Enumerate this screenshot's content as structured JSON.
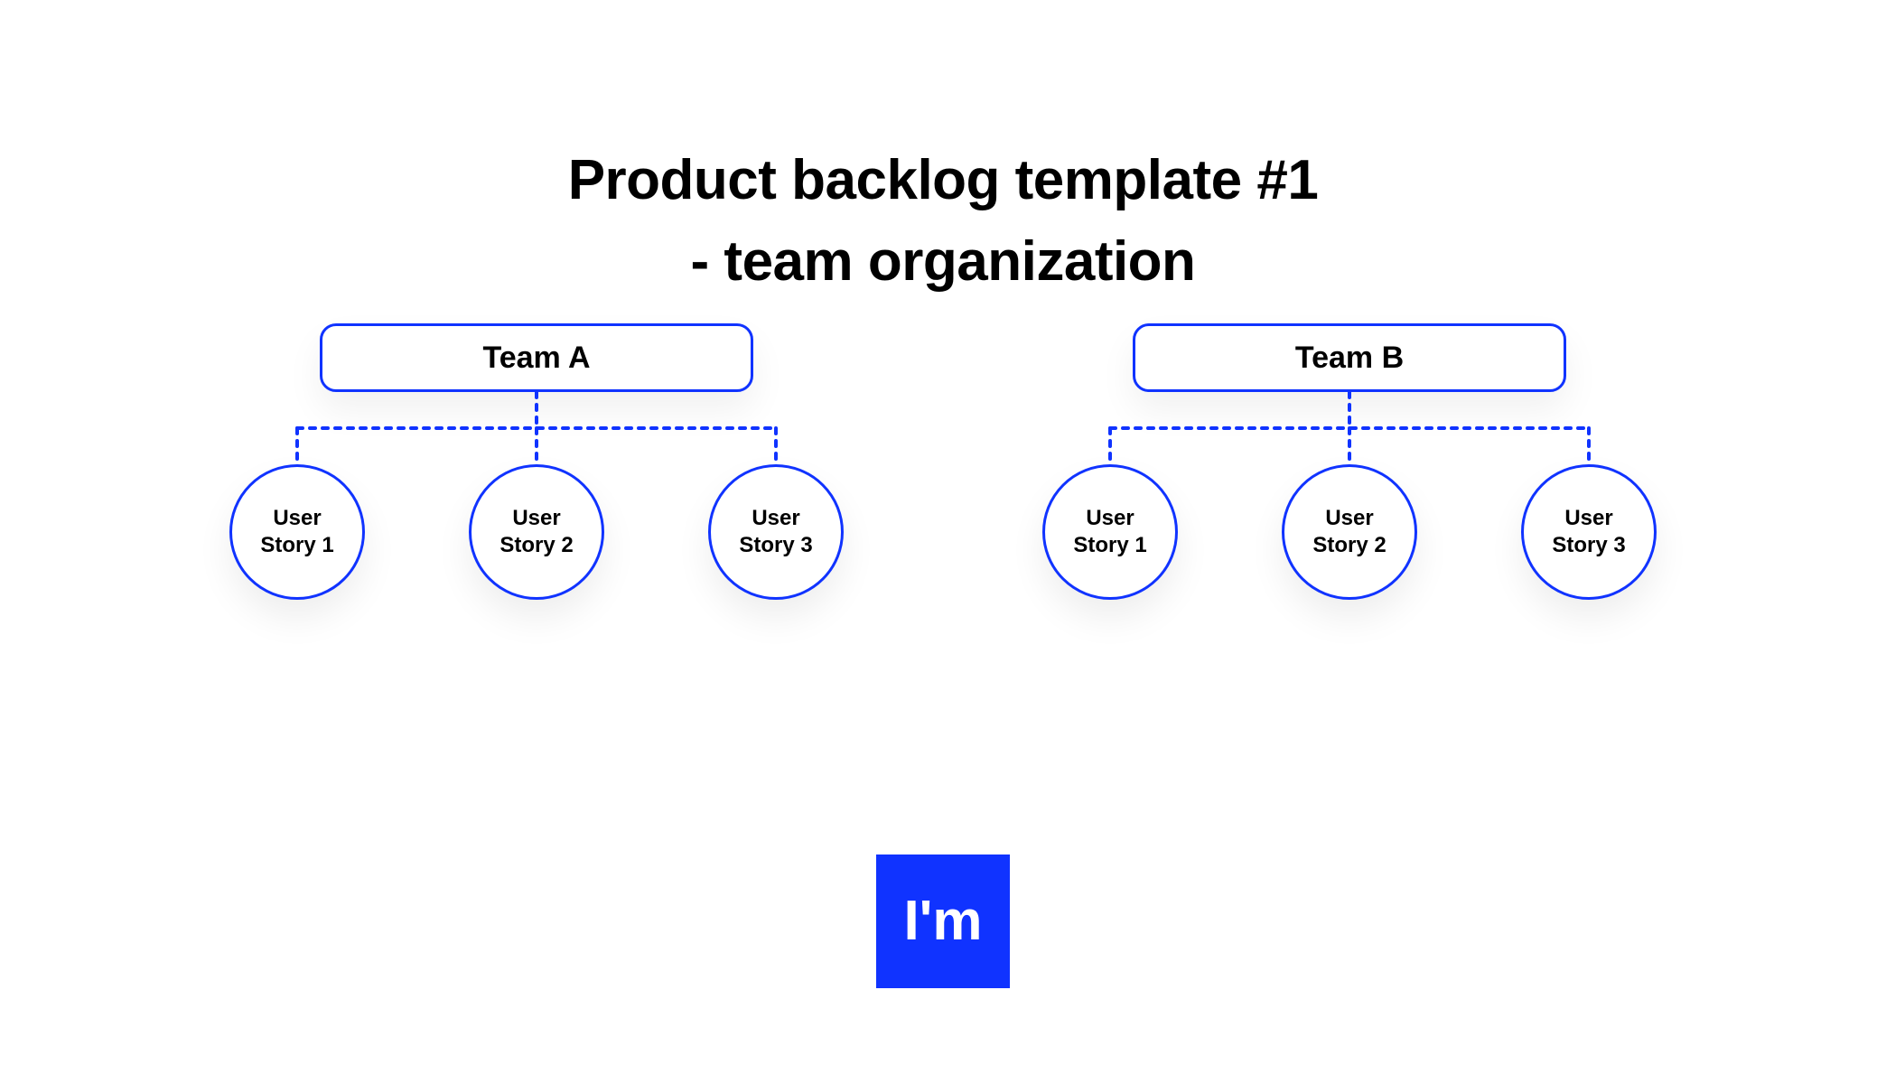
{
  "title": {
    "line1": "Product backlog template #1",
    "line2": "- team organization"
  },
  "teams": [
    {
      "name": "Team A",
      "stories": [
        {
          "line1": "User",
          "line2": "Story 1"
        },
        {
          "line1": "User",
          "line2": "Story 2"
        },
        {
          "line1": "User",
          "line2": "Story 3"
        }
      ]
    },
    {
      "name": "Team B",
      "stories": [
        {
          "line1": "User",
          "line2": "Story 1"
        },
        {
          "line1": "User",
          "line2": "Story 2"
        },
        {
          "line1": "User",
          "line2": "Story 3"
        }
      ]
    }
  ],
  "logo": {
    "text": "I'm"
  },
  "colors": {
    "accent": "#1033ff"
  }
}
